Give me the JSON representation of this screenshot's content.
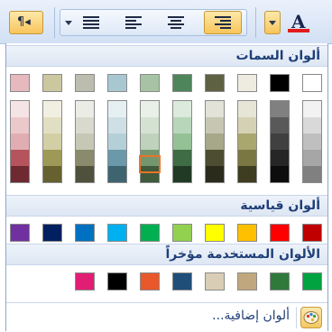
{
  "headers": {
    "theme": "ألوان السمات",
    "standard": "ألوان قياسية",
    "recent": "الألوان المستخدمة مؤخراً"
  },
  "footer": {
    "more_colors": "ألوان إضافية..."
  },
  "ribbon": {
    "font_color_letter": "A",
    "font_color_bar": "#e21b1b"
  },
  "theme_top": [
    "#ffffff",
    "#000000",
    "#eeece1",
    "#5f6143",
    "#4f855a",
    "#a6c4a3",
    "#a8c7d1",
    "#bcbdaf",
    "#cbc8a0",
    "#e5b9bd"
  ],
  "theme_columns": [
    [
      "#f2f2f2",
      "#d9d9d9",
      "#bfbfbf",
      "#a6a6a6",
      "#808080"
    ],
    [
      "#808080",
      "#595959",
      "#404040",
      "#262626",
      "#0d0d0d"
    ],
    [
      "#e7e5d6",
      "#d5d1b5",
      "#a9a76e",
      "#7a7743",
      "#3e3c21"
    ],
    [
      "#e2e2d9",
      "#c6c6b2",
      "#a7a78a",
      "#4d4d32",
      "#2b2b1c"
    ],
    [
      "#dbeadc",
      "#b8d6b9",
      "#94c196",
      "#3f6b45",
      "#213a25"
    ],
    [
      "#e9f0e8",
      "#d4e2d2",
      "#bfd3bc",
      "#73966f",
      "#3f5a3d"
    ],
    [
      "#e6eff2",
      "#cedfe5",
      "#b5cfd8",
      "#6a9aaa",
      "#3e6470"
    ],
    [
      "#ececE6",
      "#d9dacd",
      "#c6c7b4",
      "#898b6c",
      "#4f513c"
    ],
    [
      "#f0efe1",
      "#e1dfc3",
      "#d2cfa5",
      "#9e9956",
      "#66612f"
    ],
    [
      "#f5e4e5",
      "#ebc9cb",
      "#e0aeb2",
      "#b5545c",
      "#6f2a31"
    ]
  ],
  "selected_swatch": "column 6, row 4",
  "standard_colors": [
    "#c00000",
    "#ff0000",
    "#ffc000",
    "#ffff00",
    "#92d050",
    "#00b050",
    "#00b0f0",
    "#0070c0",
    "#002060",
    "#7030a0"
  ],
  "recent_colors": [
    "#00a33f",
    "#2f7a3a",
    "#c1a77d",
    "#d9cdb5",
    "#1f4e79",
    "#e8582b",
    "#000000",
    "#e11d74"
  ]
}
